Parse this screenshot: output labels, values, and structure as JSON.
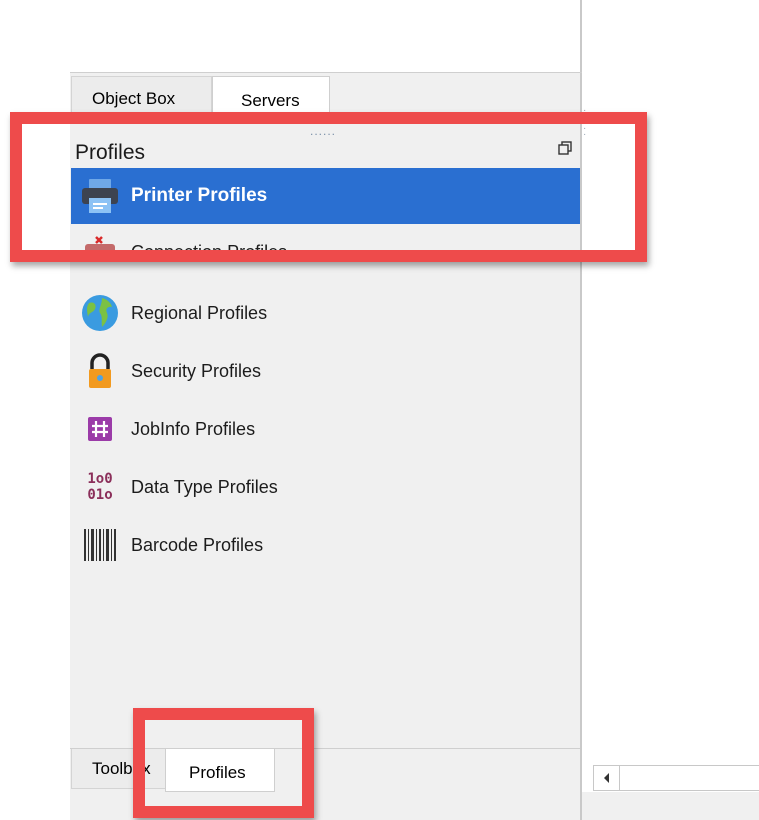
{
  "tabs_top": [
    {
      "label": "Object Box"
    },
    {
      "label": "Servers"
    }
  ],
  "panel": {
    "title": "Profiles",
    "grip": "......",
    "items": [
      {
        "label": "Printer Profiles",
        "icon": "printer-icon",
        "selected": true
      },
      {
        "label": "Connection Profiles",
        "icon": "connection-icon"
      },
      {
        "label": "Regional Profiles",
        "icon": "globe-icon"
      },
      {
        "label": "Security Profiles",
        "icon": "lock-icon"
      },
      {
        "label": "JobInfo Profiles",
        "icon": "hash-icon"
      },
      {
        "label": "Data Type Profiles",
        "icon": "binary-icon"
      },
      {
        "label": "Barcode Profiles",
        "icon": "barcode-icon"
      }
    ],
    "datatype_glyph": [
      "1o0",
      "01o"
    ]
  },
  "tabs_bottom": [
    {
      "label": "Toolbox"
    },
    {
      "label": "Profiles"
    }
  ],
  "colors": {
    "selection": "#2a6fd1",
    "highlight": "#ee4b4b",
    "panel_bg": "#f0f0f0"
  }
}
